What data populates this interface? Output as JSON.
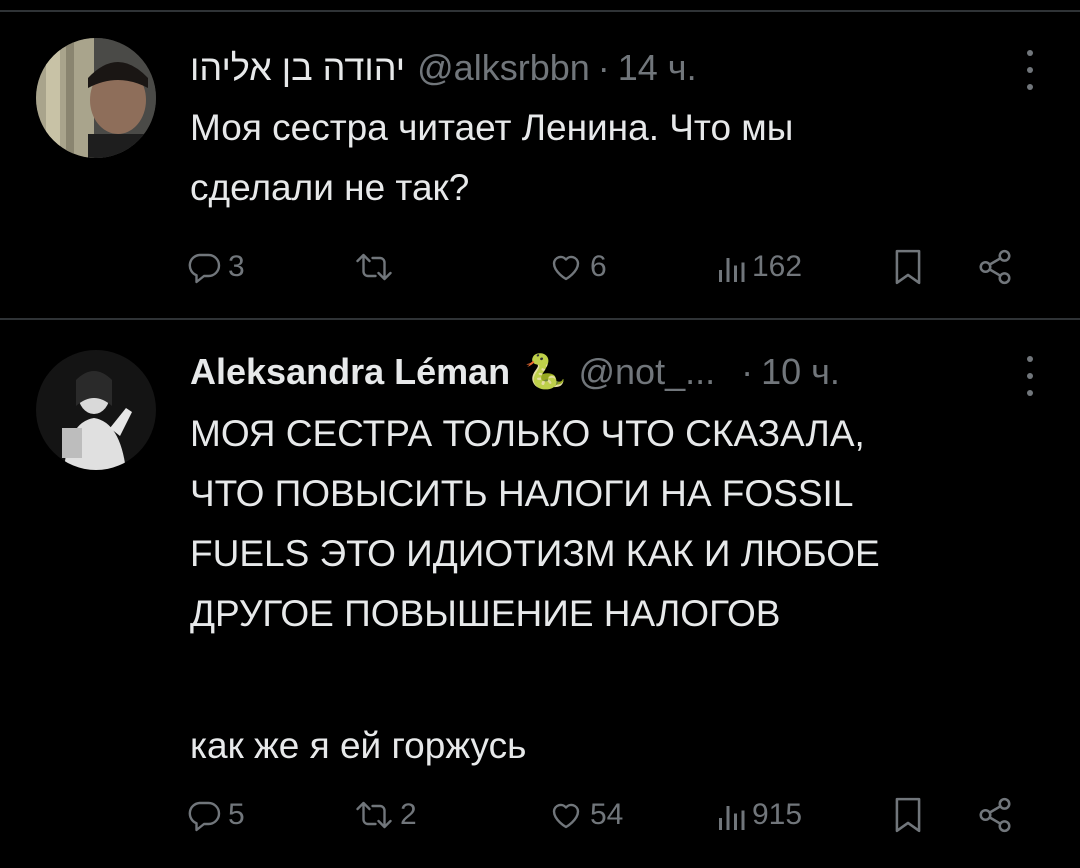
{
  "tweets": [
    {
      "name": "יהודה בן אליהו",
      "handle": "@alksrbbn",
      "separator": "·",
      "time": "14 ч.",
      "lines": [
        "Моя сестра читает Ленина. Что мы",
        "сделали не так?"
      ],
      "actions": {
        "replies": "3",
        "retweets": "",
        "likes": "6",
        "views": "162"
      }
    },
    {
      "name": "Aleksandra Léman",
      "emoji": "🐍",
      "handle": "@not_...",
      "separator": "·",
      "time": "10 ч.",
      "lines": [
        "МОЯ СЕСТРА ТОЛЬКО ЧТО СКАЗАЛА,",
        "ЧТО ПОВЫСИТЬ НАЛОГИ НА FOSSIL",
        "FUELS ЭТО ИДИОТИЗМ КАК И ЛЮБОЕ",
        "ДРУГОЕ ПОВЫШЕНИЕ НАЛОГОВ",
        "",
        "как же я ей горжусь"
      ],
      "actions": {
        "replies": "5",
        "retweets": "2",
        "likes": "54",
        "views": "915"
      }
    }
  ],
  "icons": [
    "reply-icon",
    "retweet-icon",
    "like-icon",
    "views-icon",
    "bookmark-icon",
    "share-icon",
    "more-icon"
  ]
}
